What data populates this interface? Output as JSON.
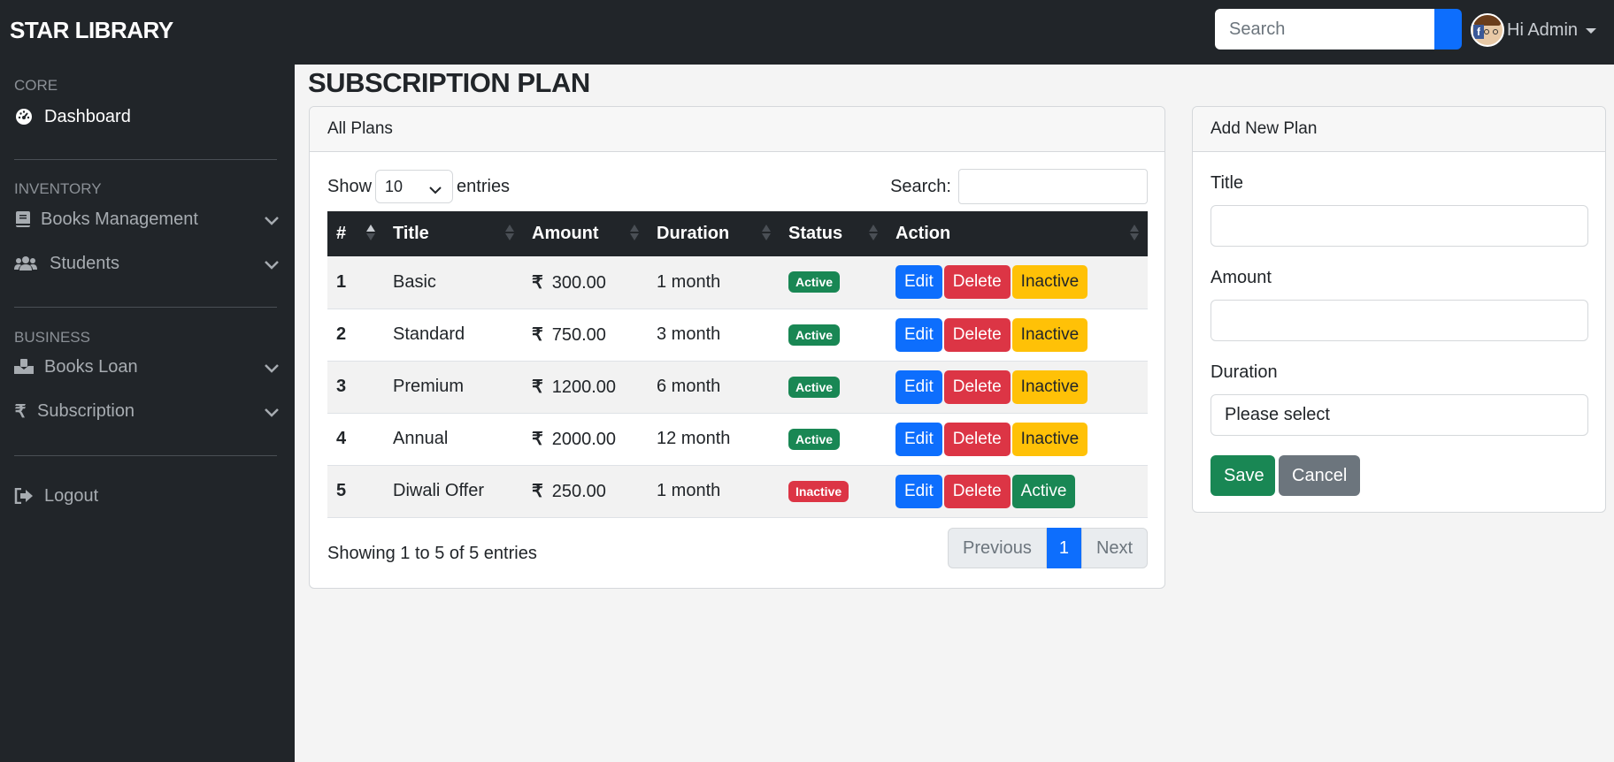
{
  "app": {
    "brand": "STAR LIBRARY"
  },
  "topbar": {
    "search_placeholder": "Search",
    "user_label": "Hi Admin"
  },
  "sidebar": {
    "sections": [
      {
        "heading": "CORE"
      },
      {
        "heading": "INVENTORY"
      },
      {
        "heading": "BUSINESS"
      }
    ],
    "items": [
      {
        "label": "Dashboard",
        "icon": "dashboard-icon"
      },
      {
        "label": "Books Management",
        "icon": "book-icon"
      },
      {
        "label": "Students",
        "icon": "users-icon"
      },
      {
        "label": "Books Loan",
        "icon": "book-loan-icon"
      },
      {
        "label": "Subscription",
        "icon": "rupee-icon"
      },
      {
        "label": "Logout",
        "icon": "logout-icon"
      }
    ]
  },
  "page": {
    "title": "SUBSCRIPTION PLAN"
  },
  "plans_card": {
    "header": "All Plans",
    "show_label": "Show",
    "entries_value": "10",
    "entries_label": "entries",
    "search_label": "Search:",
    "columns": [
      "#",
      "Title",
      "Amount",
      "Duration",
      "Status",
      "Action"
    ],
    "currency_symbol": "₹",
    "rows": [
      {
        "id": "1",
        "title": "Basic",
        "amount": "300.00",
        "duration": "1 month",
        "status": "Active",
        "toggle": "Inactive"
      },
      {
        "id": "2",
        "title": "Standard",
        "amount": "750.00",
        "duration": "3 month",
        "status": "Active",
        "toggle": "Inactive"
      },
      {
        "id": "3",
        "title": "Premium",
        "amount": "1200.00",
        "duration": "6 month",
        "status": "Active",
        "toggle": "Inactive"
      },
      {
        "id": "4",
        "title": "Annual",
        "amount": "2000.00",
        "duration": "12 month",
        "status": "Active",
        "toggle": "Inactive"
      },
      {
        "id": "5",
        "title": "Diwali Offer",
        "amount": "250.00",
        "duration": "1 month",
        "status": "Inactive",
        "toggle": "Active"
      }
    ],
    "edit_label": "Edit",
    "delete_label": "Delete",
    "info": "Showing 1 to 5 of 5 entries",
    "pager": {
      "previous": "Previous",
      "current": "1",
      "next": "Next"
    }
  },
  "form_card": {
    "header": "Add New Plan",
    "title_label": "Title",
    "title_value": "",
    "amount_label": "Amount",
    "amount_value": "",
    "duration_label": "Duration",
    "duration_value": "Please select",
    "save_label": "Save",
    "cancel_label": "Cancel"
  },
  "colors": {
    "navbar": "#212529",
    "primary": "#0d6efd",
    "success": "#198754",
    "danger": "#dc3545",
    "warning": "#ffc107",
    "secondary": "#6c757d"
  }
}
